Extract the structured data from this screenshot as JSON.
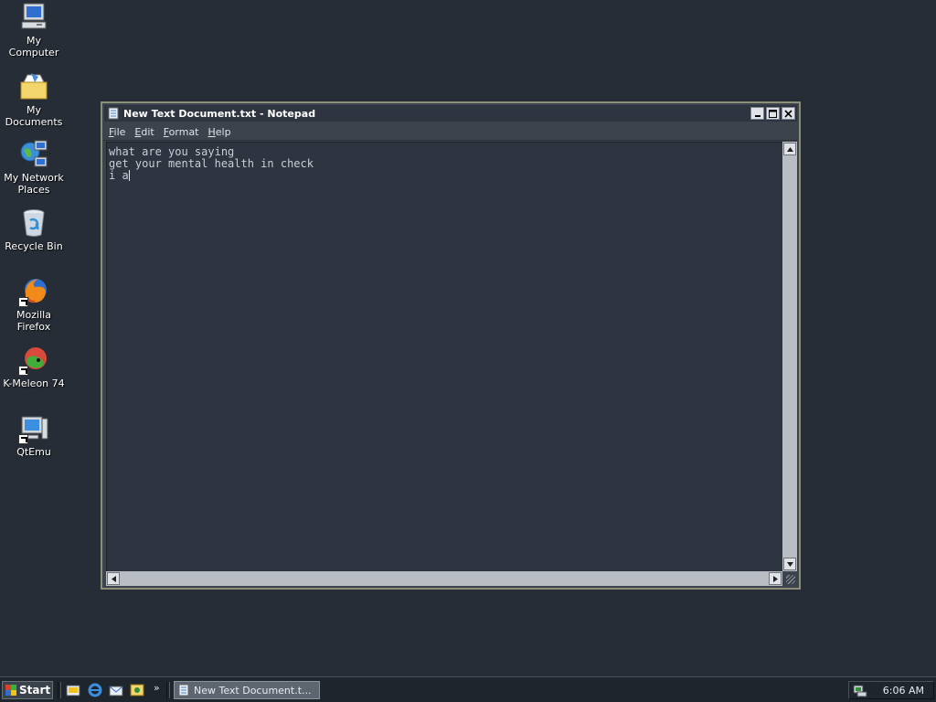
{
  "desktop": {
    "icons": [
      {
        "label": "My Computer"
      },
      {
        "label": "My Documents"
      },
      {
        "label": "My Network Places"
      },
      {
        "label": "Recycle Bin"
      },
      {
        "label": "Mozilla Firefox"
      },
      {
        "label": "K-Meleon 74"
      },
      {
        "label": "QtEmu"
      }
    ]
  },
  "notepad": {
    "title": "New Text Document.txt - Notepad",
    "menu": [
      "File",
      "Edit",
      "Format",
      "Help"
    ],
    "content_lines": [
      "what are you saying",
      "get your mental health in check",
      "i a"
    ]
  },
  "taskbar": {
    "start_label": "Start",
    "overflow": "»",
    "task_label": "New Text Document.t...",
    "clock": "6:06 AM"
  }
}
